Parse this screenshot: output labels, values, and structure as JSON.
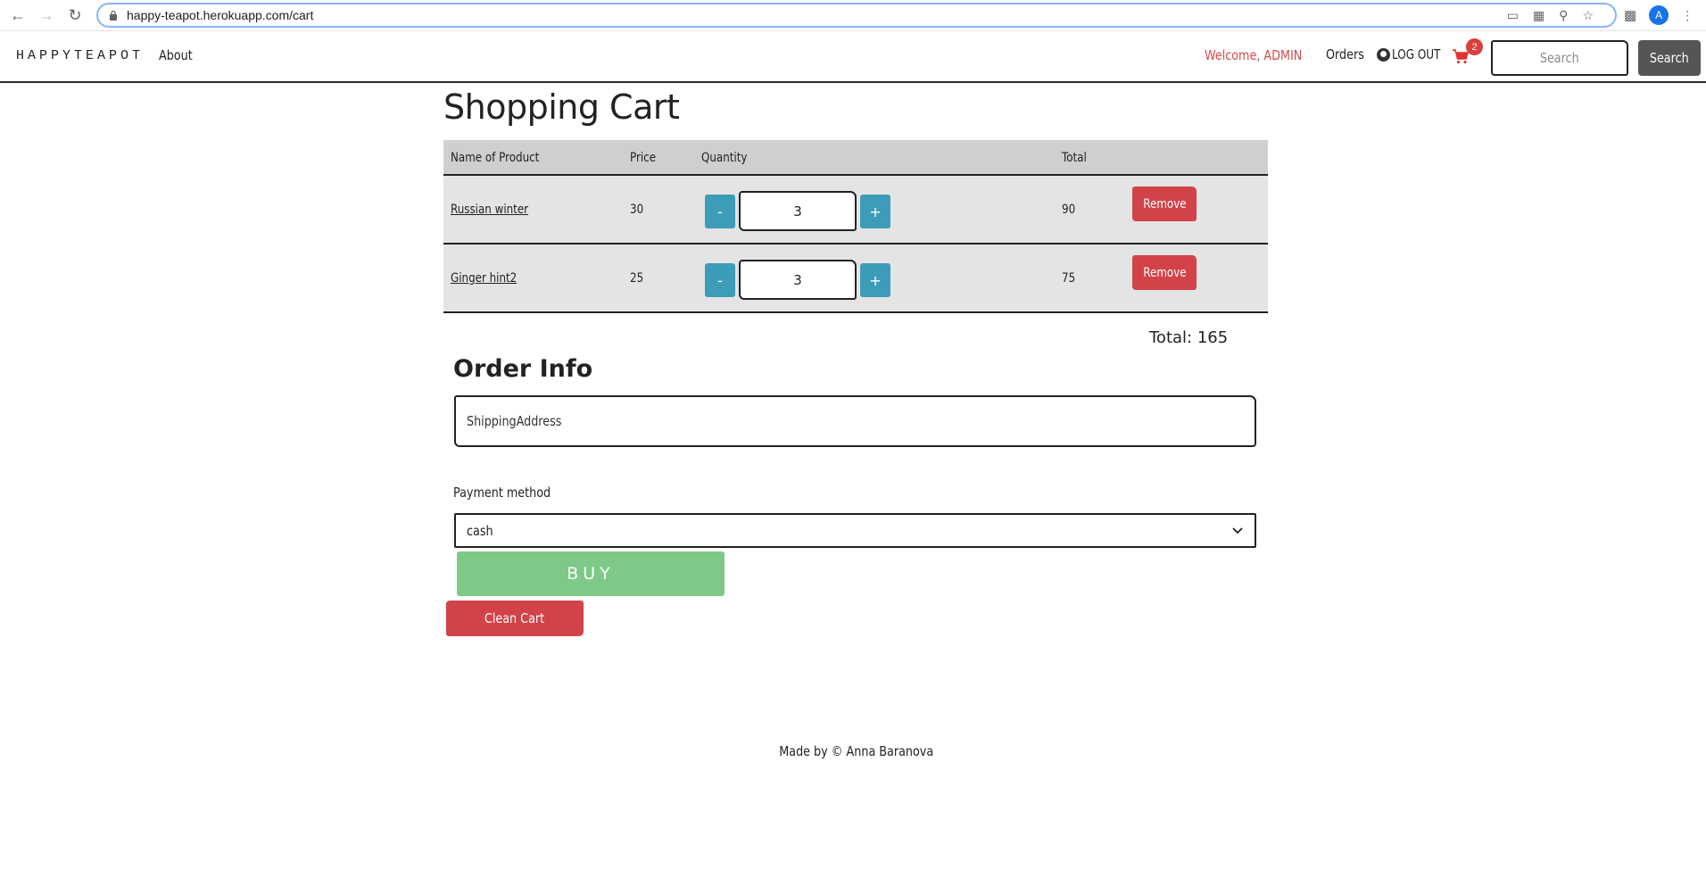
{
  "browser": {
    "url": "happy-teapot.herokuapp.com/cart",
    "avatar_letter": "A"
  },
  "nav": {
    "brand": "HAPPYTEAPOT",
    "about": "About",
    "welcome": "Welcome, ADMIN",
    "orders": "Orders",
    "logout": "LOG OUT",
    "cart_count": "2",
    "search_placeholder": "Search",
    "search_button": "Search"
  },
  "page": {
    "title": "Shopping Cart"
  },
  "table": {
    "headers": {
      "name": "Name of Product",
      "price": "Price",
      "quantity": "Quantity",
      "total": "Total"
    },
    "rows": [
      {
        "name": "Russian winter",
        "price": "30",
        "quantity": "3",
        "total": "90",
        "remove": "Remove",
        "minus": "-",
        "plus": "+"
      },
      {
        "name": "Ginger hint2",
        "price": "25",
        "quantity": "3",
        "total": "75",
        "remove": "Remove",
        "minus": "-",
        "plus": "+"
      }
    ]
  },
  "summary": {
    "total": "Total: 165"
  },
  "order": {
    "heading": "Order Info",
    "shipping_placeholder": "ShippingAddress",
    "payment_label": "Payment method",
    "payment_value": "cash",
    "buy_label": "BUY",
    "clean_label": "Clean Cart"
  },
  "footer": {
    "text": "Made by © Anna Baranova"
  },
  "colors": {
    "accent_blue": "#3d9db8",
    "remove_red": "#d24349",
    "buy_green": "#7ec987",
    "welcome_red": "#d24b4b",
    "search_btn": "#555555"
  }
}
